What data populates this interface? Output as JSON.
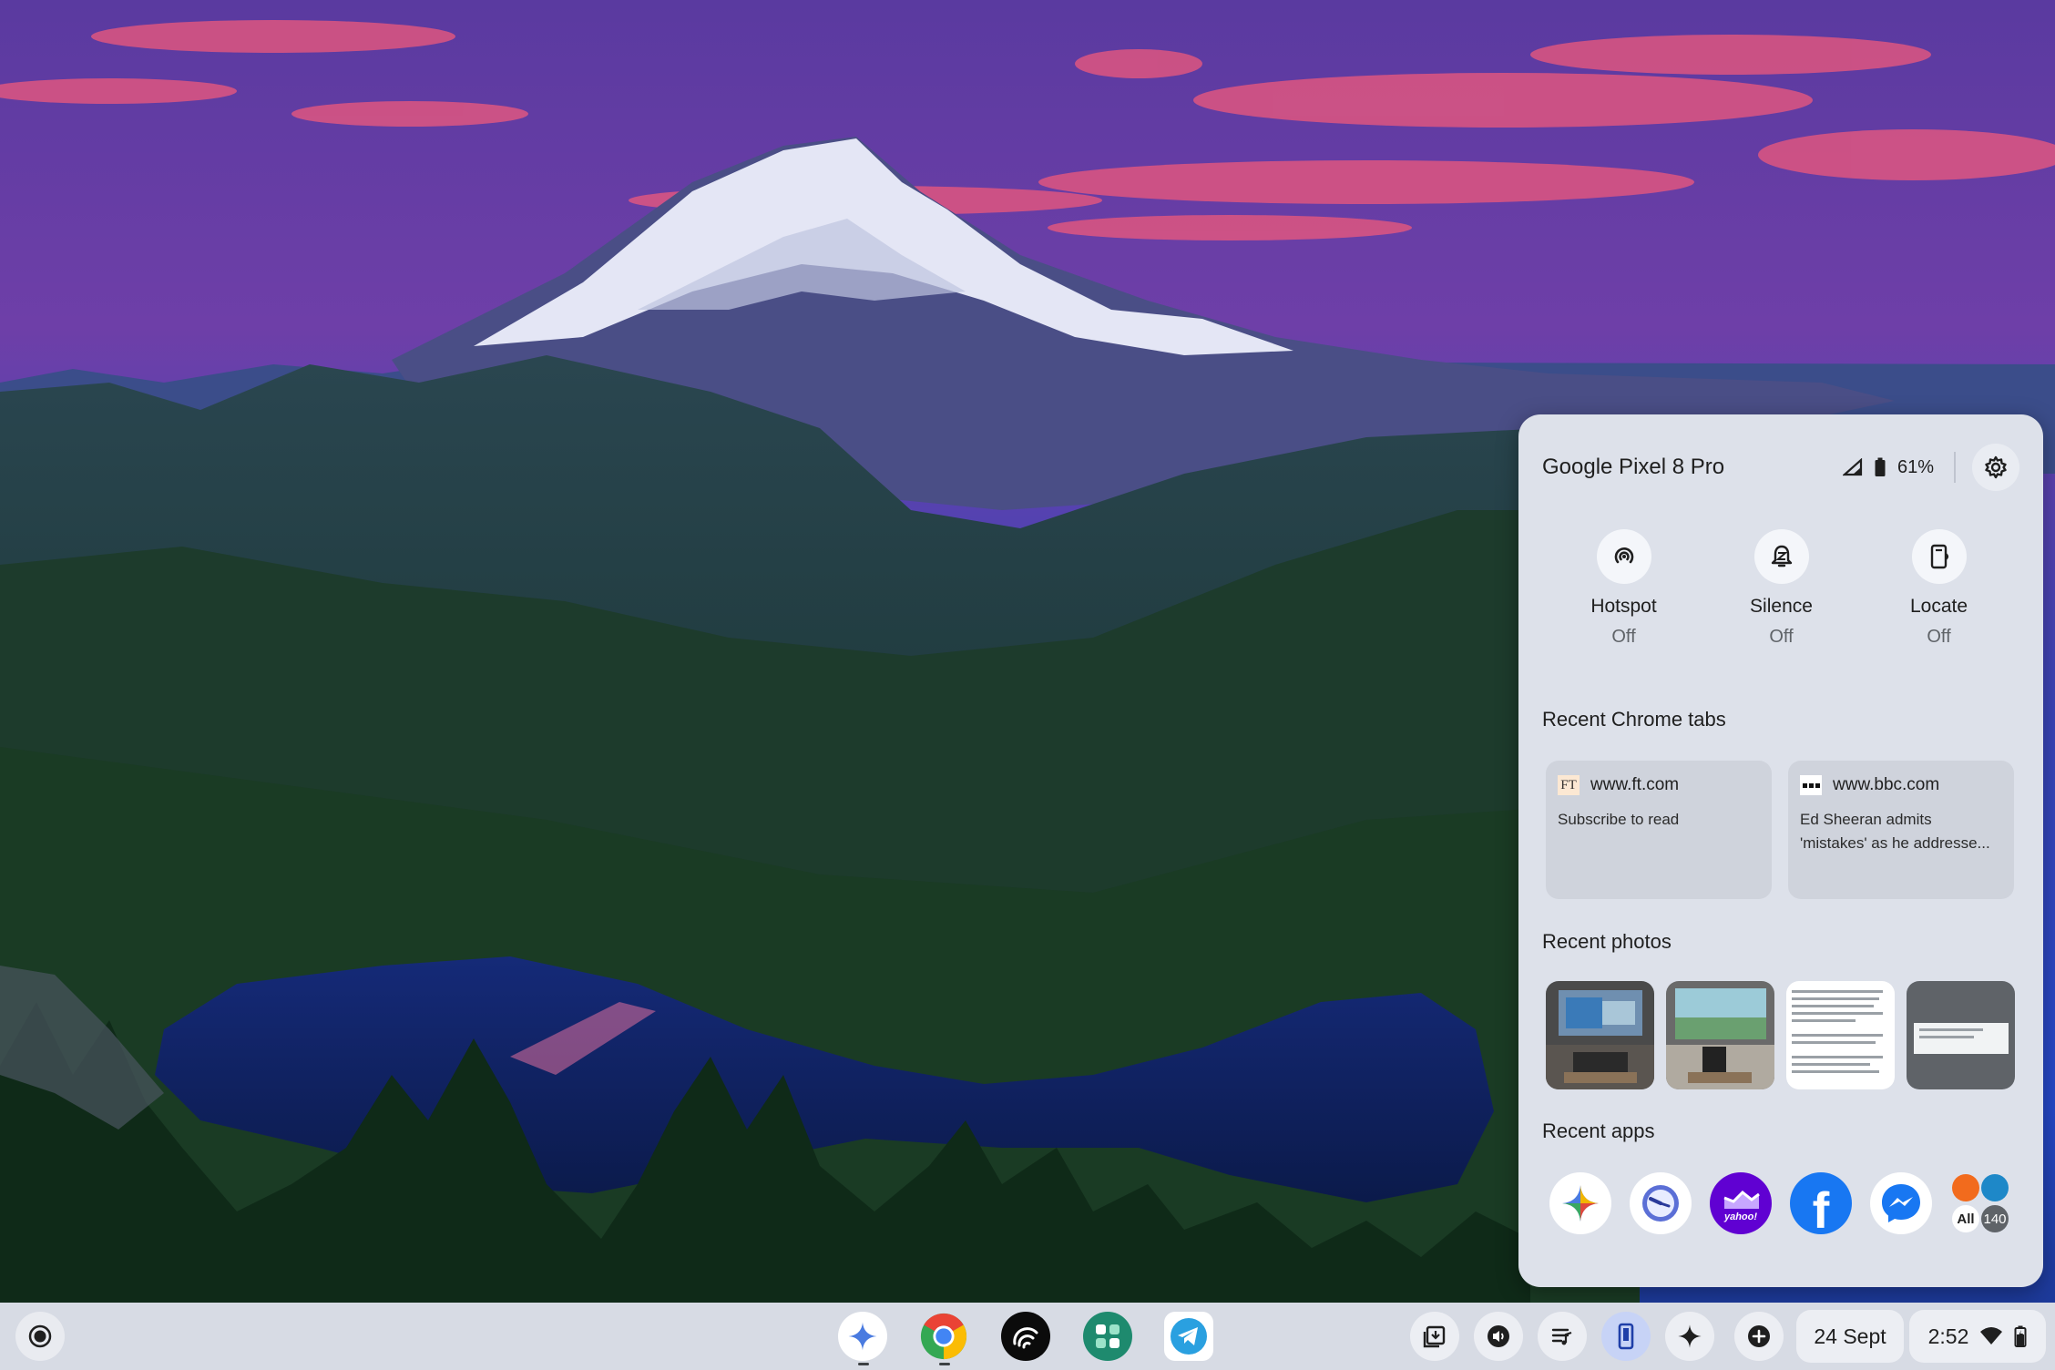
{
  "phone_hub": {
    "device_name": "Google Pixel 8 Pro",
    "battery_percent": "61%",
    "quick_actions": [
      {
        "label": "Hotspot",
        "state": "Off",
        "icon": "hotspot-icon"
      },
      {
        "label": "Silence",
        "state": "Off",
        "icon": "silence-bell-icon"
      },
      {
        "label": "Locate",
        "state": "Off",
        "icon": "locate-phone-icon"
      }
    ],
    "recent_tabs_title": "Recent Chrome tabs",
    "recent_tabs": [
      {
        "favicon_text": "FT",
        "url": "www.ft.com",
        "title": "Subscribe to read"
      },
      {
        "favicon_text": "",
        "url": "www.bbc.com",
        "title": "Ed Sheeran admits\n'mistakes' as he addresse..."
      }
    ],
    "recent_photos_title": "Recent photos",
    "recent_apps_title": "Recent apps",
    "recent_apps": [
      {
        "icon": "gemini-app-icon"
      },
      {
        "icon": "clock-app-icon"
      },
      {
        "icon": "yahoo-finance-app-icon",
        "text": "yahoo!"
      },
      {
        "icon": "facebook-app-icon",
        "text": "f"
      },
      {
        "icon": "messenger-app-icon"
      }
    ],
    "all_apps": {
      "label": "All",
      "count": "140"
    }
  },
  "shelf": {
    "apps": [
      "gemini-icon",
      "chrome-icon",
      "audible-icon",
      "app-grid-icon",
      "telegram-icon"
    ],
    "tray": {
      "date": "24 Sept",
      "time": "2:52"
    }
  },
  "colors": {
    "panel_bg": "#dde1ea",
    "shelf_bg": "#d7dbe4",
    "accent": "#4a6ee0",
    "facebook": "#1877f2",
    "yahoo": "#6001d2"
  }
}
